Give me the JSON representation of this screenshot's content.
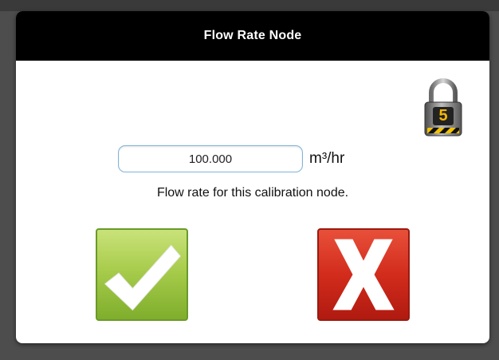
{
  "dialog": {
    "title": "Flow Rate Node",
    "lock_level": "5",
    "lock_icon": "padlock-icon",
    "value": "100.000",
    "unit": "m³/hr",
    "description": "Flow rate for this calibration node.",
    "confirm_icon": "checkmark-icon",
    "cancel_icon": "x-icon"
  },
  "colors": {
    "header": "#000000",
    "confirm": "#a8cc4c",
    "cancel": "#d22c1c",
    "input_border": "#7fb4d8"
  }
}
